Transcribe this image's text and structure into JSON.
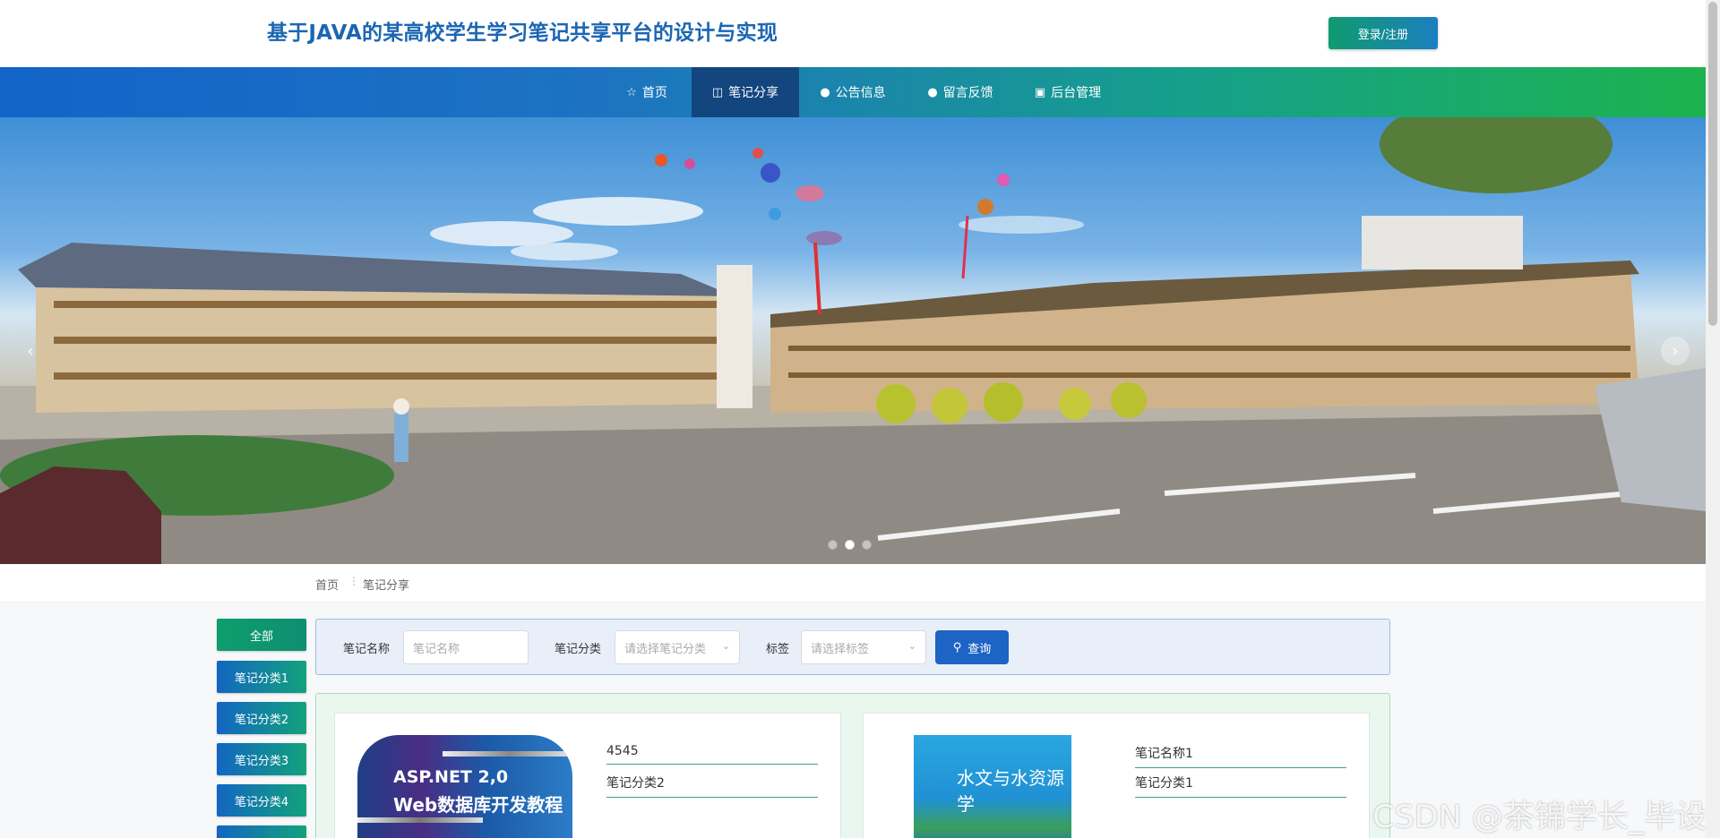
{
  "header": {
    "site_title": "基于JAVA的某高校学生学习笔记共享平台的设计与实现",
    "login_label": "登录/注册"
  },
  "nav": {
    "items": [
      {
        "label": "首页",
        "icon": "star-icon"
      },
      {
        "label": "笔记分享",
        "icon": "bag-icon"
      },
      {
        "label": "公告信息",
        "icon": "info-icon"
      },
      {
        "label": "留言反馈",
        "icon": "question-icon"
      },
      {
        "label": "后台管理",
        "icon": "briefcase-icon"
      }
    ],
    "active": "笔记分享"
  },
  "banner": {
    "current_slide": 2,
    "slide_count": 3
  },
  "breadcrumb": {
    "home": "首页",
    "current": "笔记分享"
  },
  "sidebar": {
    "categories": [
      "全部",
      "笔记分类1",
      "笔记分类2",
      "笔记分类3",
      "笔记分类4"
    ]
  },
  "search": {
    "name_label": "笔记名称",
    "name_placeholder": "笔记名称",
    "category_label": "笔记分类",
    "category_placeholder": "请选择笔记分类",
    "tag_label": "标签",
    "tag_placeholder": "请选择标签",
    "query_label": "查询"
  },
  "notes": [
    {
      "name": "4545",
      "category": "笔记分类2",
      "cover_line1": "ASP.NET 2,0",
      "cover_line2": "Web数据库开发教程"
    },
    {
      "name": "笔记名称1",
      "category": "笔记分类1",
      "cover_title": "水文与水资源学"
    }
  ],
  "watermark": "CSDN @茶锦学长_毕设",
  "colors": {
    "title_blue": "#1b66b3",
    "nav_active": "#13467f",
    "accent_green": "#34a873",
    "query_blue": "#1d64c4"
  }
}
